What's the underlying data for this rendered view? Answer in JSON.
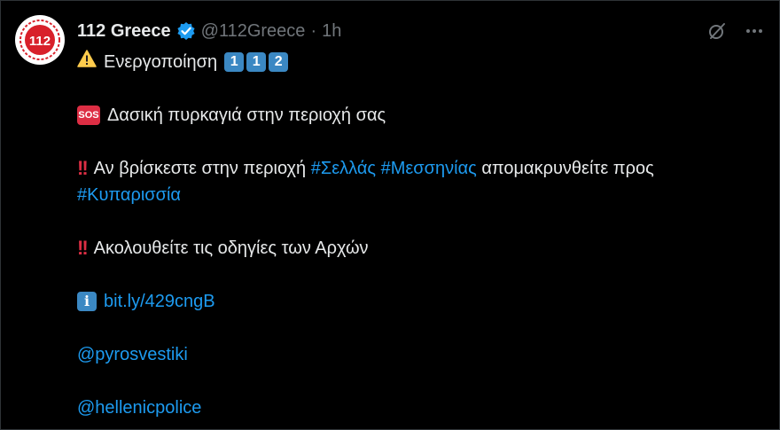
{
  "tweet": {
    "display_name": "112 Greece",
    "handle": "@112Greece",
    "separator": "·",
    "time": "1h",
    "avatar_text": "112",
    "icons": {
      "verified": "verified-badge-icon",
      "grok": "grok-icon",
      "more": "more-icon"
    },
    "lines": {
      "l1_text": "Ενεργοποίηση",
      "l1_keycaps": [
        "1",
        "1",
        "2"
      ],
      "sos_badge": "SOS",
      "l2_text": "Δασική πυρκαγιά στην περιοχή σας",
      "l3_text": "Αν βρίσκεστε στην περιοχή",
      "l3_tag1": "#Σελλάς",
      "l3_tag2": "#Μεσσηνίας",
      "l3_text2": "απομακρυνθείτε προς",
      "l3_tag3": "#Κυπαρισσία",
      "l4_text": "Ακολουθείτε τις οδηγίες των Αρχών",
      "info_glyph": "i",
      "link": "bit.ly/429cngB",
      "mention1": "@pyrosvestiki",
      "mention2": "@hellenicpolice"
    }
  },
  "colors": {
    "background": "#000000",
    "text": "#e7e9ea",
    "secondary": "#71767b",
    "link": "#1d9bf0",
    "verified": "#1d9bf0",
    "avatar_red": "#d8202a"
  }
}
